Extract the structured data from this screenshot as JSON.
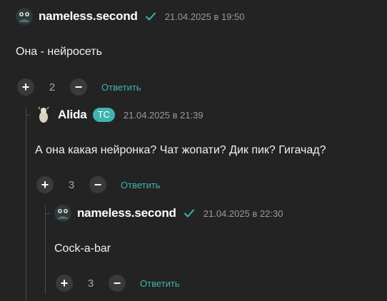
{
  "comments": [
    {
      "author": "nameless.second",
      "date": "21.04.2025 в 19:50",
      "text": "Она - нейросеть",
      "score": "2",
      "reply_label": "Ответить",
      "verified": true
    },
    {
      "author": "Alida",
      "badge": "ТС",
      "date": "21.04.2025 в 21:39",
      "text": "А она какая нейронка? Чат жопати? Дик пик? Гигачад?",
      "score": "3",
      "reply_label": "Ответить"
    },
    {
      "author": "nameless.second",
      "date": "21.04.2025 в 22:30",
      "text": "Cock-a-bar",
      "score": "3",
      "reply_label": "Ответить",
      "verified": true
    }
  ],
  "icons": {
    "verified": "check-icon",
    "upvote": "plus-icon",
    "downvote": "minus-icon"
  },
  "colors": {
    "background": "#232323",
    "accent": "#3fb3b0",
    "button": "#3a3a3a",
    "muted": "#9a9a9a"
  }
}
